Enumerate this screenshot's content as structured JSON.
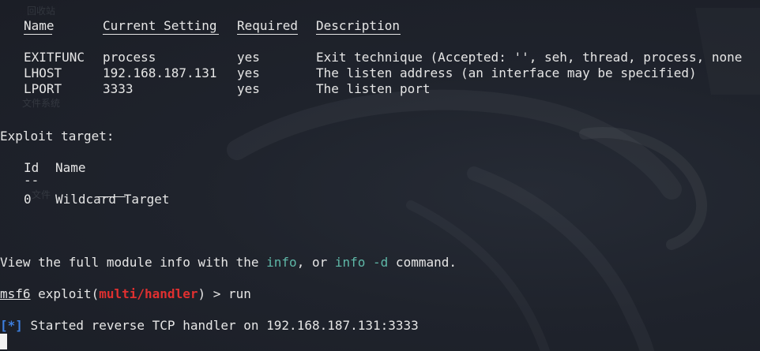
{
  "background": {
    "ghost_labels": [
      "回收站",
      "文件系统",
      "文件"
    ]
  },
  "options_table": {
    "headers": [
      "Name",
      "Current Setting",
      "Required",
      "Description"
    ],
    "rows": [
      [
        "EXITFUNC",
        "process",
        "yes",
        "Exit technique (Accepted: '', seh, thread, process, none"
      ],
      [
        "LHOST",
        "192.168.187.131",
        "yes",
        "The listen address (an interface may be specified)"
      ],
      [
        "LPORT",
        "3333",
        "yes",
        "The listen port"
      ]
    ]
  },
  "exploit_target": {
    "heading": "Exploit target:",
    "headers": [
      "Id",
      "Name"
    ],
    "underlines": [
      "--",
      "----"
    ],
    "rows": [
      [
        "0",
        "Wildcard Target"
      ]
    ]
  },
  "info_hint": {
    "prefix": "View the full module info with the ",
    "cmd1": "info",
    "mid": ", or ",
    "cmd2": "info -d",
    "suffix": " command."
  },
  "prompt": {
    "msf": "msf6",
    "pre": " exploit(",
    "module": "multi/handler",
    "post": ") > run"
  },
  "status_line": {
    "marker": "[*]",
    "text": " Started reverse TCP handler on 192.168.187.131:3333"
  },
  "colors": {
    "background": "#1e222b",
    "text": "#e6e6e6",
    "command_highlight": "#5fb8a8",
    "module_red": "#e03030",
    "status_blue": "#3d7fe0"
  }
}
